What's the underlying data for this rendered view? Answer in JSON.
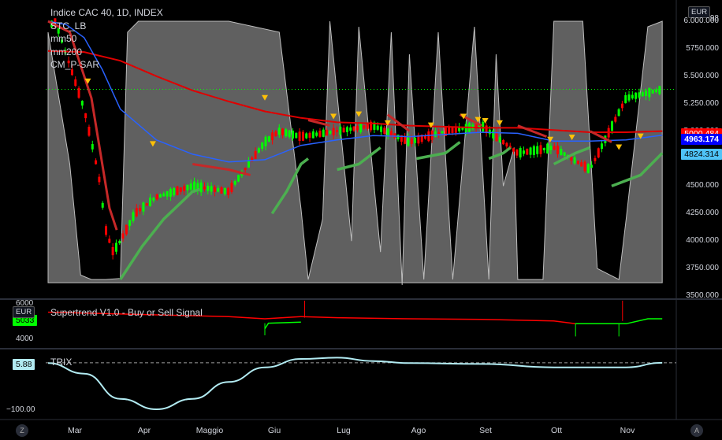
{
  "legend": {
    "title": "Indice CAC 40, 1D, INDEX",
    "studies": [
      "STC_LB",
      "mm50",
      "mm200",
      "CM_P-SAR"
    ]
  },
  "currency_main": "EUR",
  "currency_sub": "EUR",
  "main_axis": {
    "ticks": [
      "6.000.000",
      "5750.000",
      "5.500.000",
      "5.250.000",
      "5.000.000",
      "4750.000",
      "4500.000",
      "4250.000",
      "4000.000",
      "3750.000",
      "3500.000"
    ],
    "top_partial": "98",
    "price_badges": [
      {
        "label": "5000.484",
        "bg": "#ff0000",
        "fg": "#ffffff"
      },
      {
        "label": "4963.174",
        "bg": "#0000ff",
        "fg": "#ffffff"
      },
      {
        "label": "4824.314",
        "bg": "#4fc3f7",
        "fg": "#000000"
      }
    ]
  },
  "supertrend": {
    "title": "Supertrend V1.0 - Buy or Sell Signal",
    "ticks": [
      "6000",
      "4000"
    ],
    "badge": "5033",
    "badge_color": "#00ff00"
  },
  "trix": {
    "title": "TRIX",
    "ticks": [
      "−100.00"
    ],
    "badge": "5.88",
    "badge_color": "#b2ebf2"
  },
  "x_axis": [
    "Mar",
    "Apr",
    "Maggio",
    "Giu",
    "Lug",
    "Ago",
    "Set",
    "Ott",
    "Nov"
  ],
  "buttons": {
    "z": "Z",
    "a": "A"
  },
  "colors": {
    "up": "#00ff00",
    "down": "#ff0000",
    "mm50": "#2962ff",
    "mm200": "#e00000",
    "stc": "#808080",
    "psar_up": "#4caf50",
    "psar_down": "#c62828",
    "trix": "#b2ebf2",
    "signal": "#ffc107"
  },
  "chart_data": [
    {
      "type": "line",
      "title": "Indice CAC 40, 1D, INDEX",
      "x_categories": [
        "Mar",
        "Apr",
        "Maggio",
        "Giu",
        "Lug",
        "Ago",
        "Set",
        "Ott",
        "Nov"
      ],
      "ylim": [
        3500,
        6050
      ],
      "series": [
        {
          "name": "mm50",
          "points": [
            [
              0,
              6000
            ],
            [
              0.25,
              5970
            ],
            [
              0.5,
              5850
            ],
            [
              0.75,
              5560
            ],
            [
              1,
              5200
            ],
            [
              1.5,
              4920
            ],
            [
              2,
              4790
            ],
            [
              2.5,
              4720
            ],
            [
              3,
              4740
            ],
            [
              3.5,
              4870
            ],
            [
              4,
              4920
            ],
            [
              4.5,
              4960
            ],
            [
              5,
              4950
            ],
            [
              5.5,
              4970
            ],
            [
              6,
              4990
            ],
            [
              6.5,
              4980
            ],
            [
              7,
              4910
            ],
            [
              7.5,
              4910
            ],
            [
              8,
              4920
            ],
            [
              8.5,
              4963
            ]
          ]
        },
        {
          "name": "mm200",
          "points": [
            [
              0,
              5730
            ],
            [
              0.5,
              5720
            ],
            [
              1,
              5640
            ],
            [
              1.5,
              5500
            ],
            [
              2,
              5370
            ],
            [
              2.5,
              5270
            ],
            [
              3,
              5180
            ],
            [
              3.5,
              5120
            ],
            [
              4,
              5080
            ],
            [
              4.5,
              5070
            ],
            [
              5,
              5050
            ],
            [
              5.5,
              5040
            ],
            [
              6,
              5030
            ],
            [
              6.5,
              5030
            ],
            [
              7,
              5010
            ],
            [
              7.5,
              4990
            ],
            [
              8,
              4990
            ],
            [
              8.5,
              5000
            ]
          ]
        },
        {
          "name": "STC_LB",
          "points": [
            [
              0,
              5900
            ],
            [
              0.3,
              4700
            ],
            [
              0.45,
              3690
            ],
            [
              0.6,
              3650
            ],
            [
              0.8,
              3650
            ],
            [
              1,
              3660
            ],
            [
              1.1,
              5900
            ],
            [
              1.25,
              6000
            ],
            [
              2.5,
              6000
            ],
            [
              3.2,
              5900
            ],
            [
              3.5,
              4300
            ],
            [
              3.6,
              3650
            ],
            [
              3.8,
              4200
            ],
            [
              3.9,
              6000
            ],
            [
              4.2,
              4000
            ],
            [
              4.3,
              5950
            ],
            [
              4.6,
              3900
            ],
            [
              4.75,
              5900
            ],
            [
              4.9,
              3600
            ],
            [
              5.0,
              5700
            ],
            [
              5.2,
              3650
            ],
            [
              5.4,
              5900
            ],
            [
              5.6,
              3650
            ],
            [
              5.9,
              5950
            ],
            [
              6.1,
              3650
            ],
            [
              6.2,
              5700
            ],
            [
              6.3,
              4500
            ],
            [
              6.45,
              4850
            ],
            [
              6.5,
              3650
            ],
            [
              6.85,
              3650
            ],
            [
              7.0,
              6000
            ],
            [
              7.4,
              6000
            ],
            [
              7.6,
              3750
            ],
            [
              7.9,
              3650
            ],
            [
              8.0,
              4200
            ],
            [
              8.3,
              5950
            ],
            [
              8.5,
              6000
            ]
          ]
        }
      ],
      "candles_approx": [
        [
          1.0,
          4000
        ],
        [
          1.2,
          4250
        ],
        [
          1.5,
          4400
        ],
        [
          2,
          4500
        ],
        [
          2.5,
          4450
        ],
        [
          3,
          4900
        ],
        [
          3.2,
          5000
        ],
        [
          3.5,
          4950
        ],
        [
          4,
          5000
        ],
        [
          4.5,
          5050
        ],
        [
          5,
          4900
        ],
        [
          5.5,
          5000
        ],
        [
          6,
          5050
        ],
        [
          6.5,
          4800
        ],
        [
          7,
          4850
        ],
        [
          7.5,
          4650
        ],
        [
          8,
          5300
        ],
        [
          8.5,
          5380
        ]
      ]
    },
    {
      "type": "line",
      "title": "Supertrend V1.0 - Buy or Sell Signal",
      "ylim": [
        3000,
        7000
      ],
      "series": [
        {
          "name": "",
          "points": [
            [
              0,
              6100
            ],
            [
              2.5,
              5700
            ],
            [
              3,
              5500
            ],
            [
              3.5,
              5700
            ],
            [
              4,
              5600
            ],
            [
              5,
              5500
            ],
            [
              6,
              5450
            ],
            [
              7,
              5300
            ],
            [
              7.3,
              5050
            ],
            [
              8.5,
              5033
            ]
          ]
        }
      ]
    },
    {
      "type": "line",
      "title": "TRIX",
      "ylim": [
        -120,
        30
      ],
      "series": [
        {
          "name": "",
          "points": [
            [
              0,
              5
            ],
            [
              0.5,
              -20
            ],
            [
              1,
              -80
            ],
            [
              1.5,
              -105
            ],
            [
              2,
              -80
            ],
            [
              2.5,
              -40
            ],
            [
              3,
              -5
            ],
            [
              3.5,
              15
            ],
            [
              4,
              18
            ],
            [
              4.5,
              10
            ],
            [
              5,
              5
            ],
            [
              6,
              3
            ],
            [
              7,
              -5
            ],
            [
              8,
              -5
            ],
            [
              8.5,
              5.88
            ]
          ]
        }
      ]
    }
  ]
}
